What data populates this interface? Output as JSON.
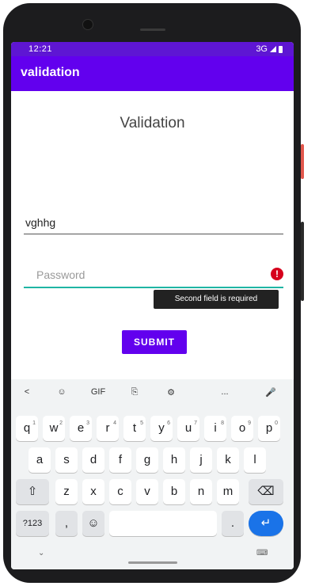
{
  "status_bar": {
    "time": "12:21",
    "network": "3G"
  },
  "app_bar": {
    "title": "validation"
  },
  "heading": "Validation",
  "username_field": {
    "value": "vghhg"
  },
  "password_field": {
    "placeholder": "Password",
    "error": "Second field is required"
  },
  "submit_label": "SUBMIT",
  "keyboard": {
    "toolbar": [
      "<",
      "☺",
      "GIF",
      "⎘",
      "⚙",
      "...",
      "🎤"
    ],
    "row1": [
      {
        "k": "q",
        "s": "1"
      },
      {
        "k": "w",
        "s": "2"
      },
      {
        "k": "e",
        "s": "3"
      },
      {
        "k": "r",
        "s": "4"
      },
      {
        "k": "t",
        "s": "5"
      },
      {
        "k": "y",
        "s": "6"
      },
      {
        "k": "u",
        "s": "7"
      },
      {
        "k": "i",
        "s": "8"
      },
      {
        "k": "o",
        "s": "9"
      },
      {
        "k": "p",
        "s": "0"
      }
    ],
    "row2": [
      "a",
      "s",
      "d",
      "f",
      "g",
      "h",
      "j",
      "k",
      "l"
    ],
    "row3": [
      "z",
      "x",
      "c",
      "v",
      "b",
      "n",
      "m"
    ],
    "shift": "⇧",
    "backspace": "⌫",
    "symbols": "?123",
    "comma": ",",
    "emoji": "☺",
    "period": ".",
    "enter": "↵",
    "collapse": "⌄",
    "switch_kb": "⌨"
  }
}
